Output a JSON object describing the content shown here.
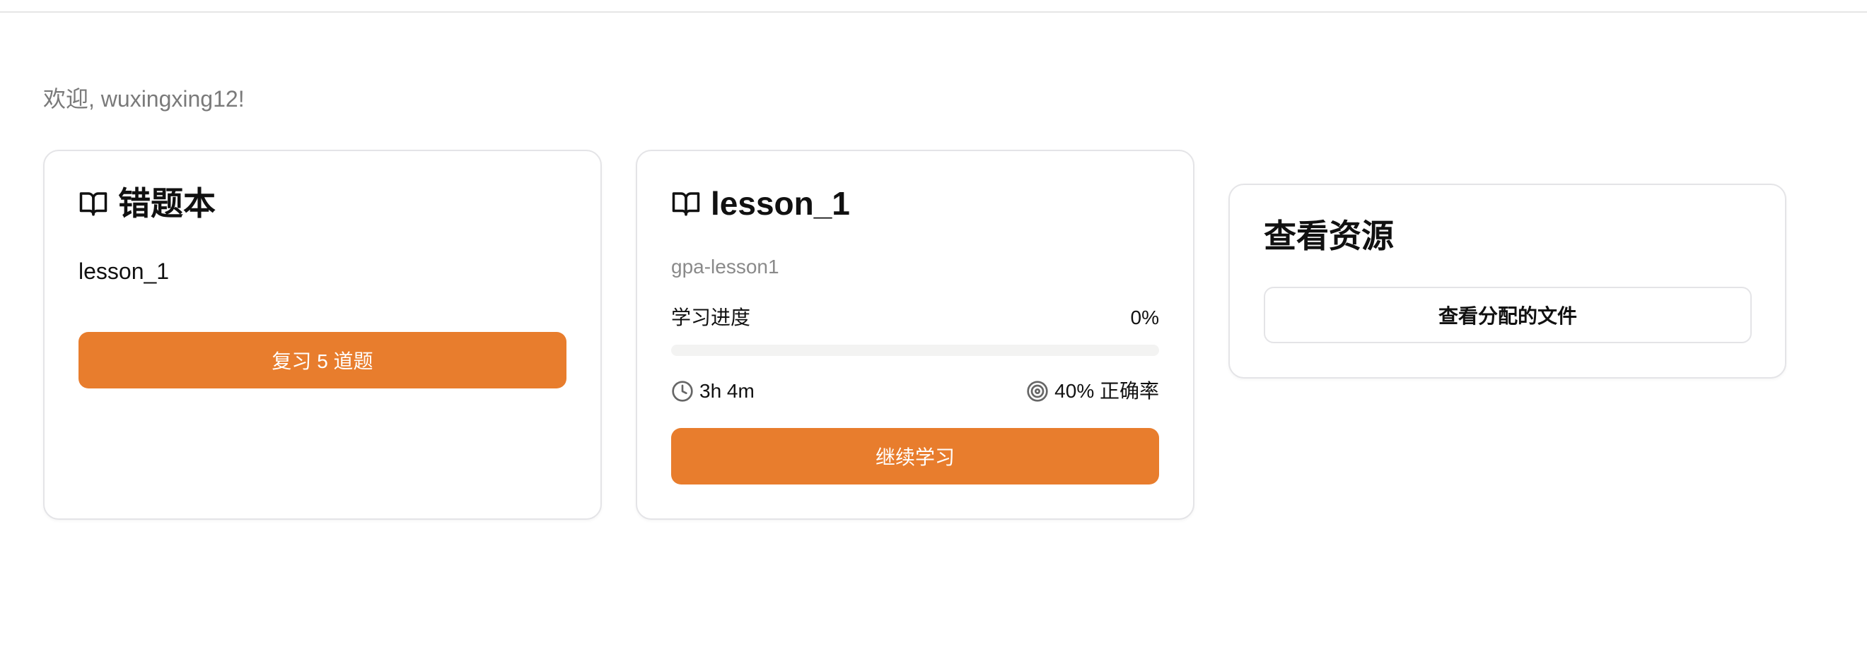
{
  "welcome_text": "欢迎, wuxingxing12!",
  "mistakes_card": {
    "title": "错题本",
    "title_icon": "book-open-icon",
    "lesson": "lesson_1",
    "review_button": "复习 5 道题"
  },
  "lesson_card": {
    "title": "lesson_1",
    "title_icon": "book-open-icon",
    "subtitle": "gpa-lesson1",
    "progress_label": "学习进度",
    "progress_value": "0%",
    "progress_fraction": 0,
    "time_icon": "clock-icon",
    "time_spent": "3h 4m",
    "accuracy_icon": "target-icon",
    "accuracy": "40% 正确率",
    "continue_button": "继续学习"
  },
  "resources_card": {
    "title": "查看资源",
    "view_files_button": "查看分配的文件"
  },
  "colors": {
    "accent": "#e87d2d",
    "border": "#e4e4e7",
    "muted_text": "#7a7a7a"
  }
}
